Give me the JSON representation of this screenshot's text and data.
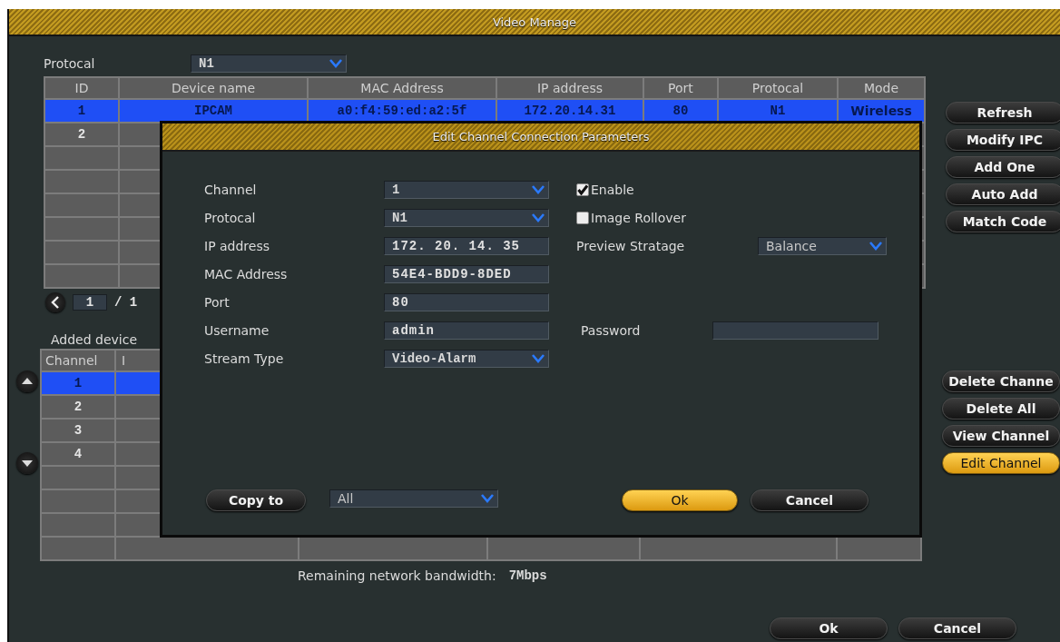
{
  "window": {
    "title": "Video Manage"
  },
  "protocol_filter": {
    "label": "Protocal",
    "value": "N1"
  },
  "device_table": {
    "columns": [
      "ID",
      "Device name",
      "MAC Address",
      "IP address",
      "Port",
      "Protocal",
      "Mode"
    ],
    "rows": [
      {
        "selected": true,
        "cells": [
          "1",
          "IPCAM",
          "a0:f4:59:ed:a2:5f",
          "172.20.14.31",
          "80",
          "N1",
          "Wireless"
        ]
      },
      {
        "selected": false,
        "cells": [
          "2"
        ]
      }
    ]
  },
  "device_buttons": [
    {
      "label": "Refresh",
      "highlighted": false
    },
    {
      "label": "Modify IPC",
      "highlighted": false
    },
    {
      "label": "Add One",
      "highlighted": false
    },
    {
      "label": "Auto Add",
      "highlighted": false
    },
    {
      "label": "Match Code",
      "highlighted": false
    }
  ],
  "pager": {
    "page": "1",
    "total": "/ 1"
  },
  "added_devices": {
    "label": "Added device"
  },
  "channel_table": {
    "columns": [
      "Channel",
      "I"
    ],
    "rows": [
      {
        "selected": true,
        "cells": [
          "1"
        ]
      },
      {
        "selected": false,
        "cells": [
          "2"
        ]
      },
      {
        "selected": false,
        "cells": [
          "3"
        ]
      },
      {
        "selected": false,
        "cells": [
          "4"
        ]
      }
    ]
  },
  "channel_buttons": [
    {
      "label": "Delete Channe",
      "highlighted": false
    },
    {
      "label": "Delete All",
      "highlighted": false
    },
    {
      "label": "View Channel",
      "highlighted": false
    },
    {
      "label": "Edit Channel",
      "highlighted": true
    }
  ],
  "bandwidth": {
    "label": "Remaining network bandwidth:",
    "value": "7Mbps"
  },
  "footer_buttons": [
    {
      "label": "Ok",
      "highlighted": false
    },
    {
      "label": "Cancel",
      "highlighted": false
    }
  ],
  "dialog": {
    "title": "Edit Channel Connection Parameters",
    "fields": [
      {
        "kind": "select",
        "label": "Channel",
        "value": "1",
        "side": {
          "kind": "checkbox",
          "label": "Enable",
          "checked": true
        }
      },
      {
        "kind": "select",
        "label": "Protocal",
        "value": "N1",
        "side": {
          "kind": "checkbox",
          "label": "Image Rollover",
          "checked": false
        }
      },
      {
        "kind": "text",
        "label": "IP address",
        "value": "172. 20. 14. 35",
        "side": {
          "kind": "select",
          "label": "Preview Stratage",
          "value": "Balance"
        }
      },
      {
        "kind": "text",
        "label": "MAC Address",
        "value": "54E4-BDD9-8DED"
      },
      {
        "kind": "text",
        "label": "Port",
        "value": "80"
      },
      {
        "kind": "text",
        "label": "Username",
        "value": "admin",
        "side": {
          "kind": "password",
          "label": "Password"
        }
      },
      {
        "kind": "select",
        "label": "Stream Type",
        "value": "Video-Alarm"
      }
    ],
    "copy": {
      "button": "Copy to",
      "target": "All"
    },
    "buttons": [
      {
        "label": "Ok",
        "highlighted": true
      },
      {
        "label": "Cancel",
        "highlighted": false
      }
    ]
  }
}
